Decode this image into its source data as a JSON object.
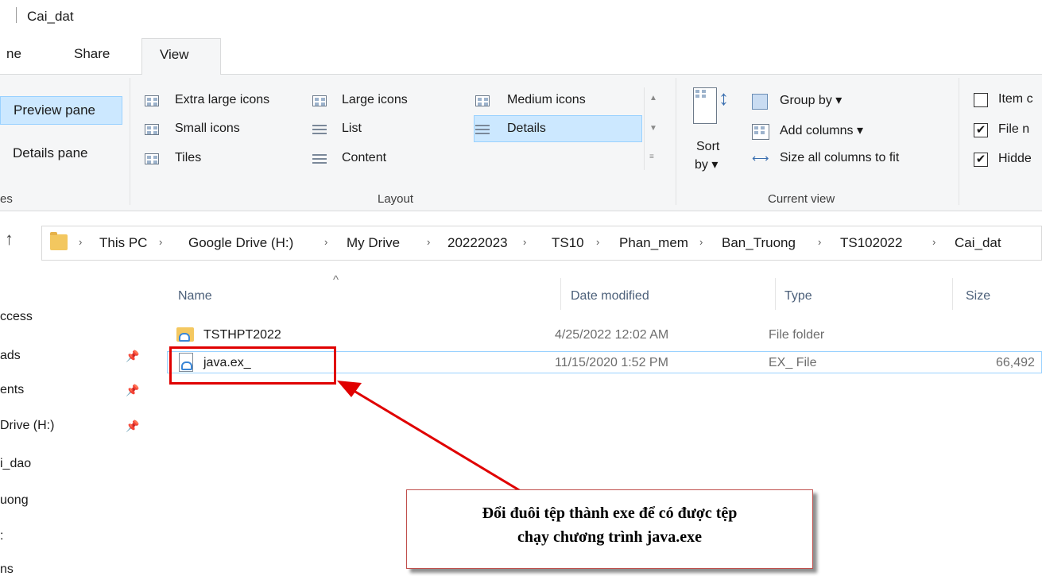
{
  "window": {
    "title": "Cai_dat"
  },
  "tabs": {
    "home": "ne",
    "share": "Share",
    "view": "View"
  },
  "ribbon": {
    "panes": {
      "preview": "Preview pane",
      "details": "Details pane",
      "group_label": "es"
    },
    "layout": {
      "extra_large": "Extra large icons",
      "large": "Large icons",
      "medium": "Medium icons",
      "small": "Small icons",
      "list": "List",
      "details": "Details",
      "tiles": "Tiles",
      "content": "Content",
      "group_label": "Layout"
    },
    "current_view": {
      "sort_by": "Sort",
      "sort_by2": "by ▾",
      "group_by": "Group by ▾",
      "add_columns": "Add columns ▾",
      "size_all": "Size all columns to fit",
      "group_label": "Current view"
    },
    "show_hide": {
      "item_check": "Item c",
      "file_ext": "File n",
      "hidden": "Hidde",
      "item_checked": false,
      "file_ext_checked": true,
      "hidden_checked": true
    }
  },
  "address": {
    "crumbs": [
      "This PC",
      "Google Drive (H:)",
      "My Drive",
      "20222023",
      "TS10",
      "Phan_mem",
      "Ban_Truong",
      "TS102022",
      "Cai_dat"
    ]
  },
  "nav": {
    "items": [
      {
        "label": "ccess",
        "pinned": false
      },
      {
        "label": "ads",
        "pinned": true
      },
      {
        "label": "ents",
        "pinned": true
      },
      {
        "label": "Drive (H:)",
        "pinned": true
      },
      {
        "label": "i_dao",
        "pinned": false
      },
      {
        "label": "uong",
        "pinned": false
      },
      {
        "label": ":",
        "pinned": false
      },
      {
        "label": "ns",
        "pinned": false
      }
    ]
  },
  "files": {
    "columns": {
      "name": "Name",
      "date": "Date modified",
      "type": "Type",
      "size": "Size"
    },
    "rows": [
      {
        "name": "TSTHPT2022",
        "date": "4/25/2022 12:02 AM",
        "type": "File folder",
        "size": "",
        "icon": "cloud-folder-icon"
      },
      {
        "name": "java.ex_",
        "date": "11/15/2020 1:52 PM",
        "type": "EX_ File",
        "size": "66,492",
        "icon": "cloud-file-icon"
      }
    ]
  },
  "annotation": {
    "line1": "Đổi đuôi tệp thành exe để có được tệp",
    "line2": "chạy chương trình java.exe",
    "color": "#e00000"
  }
}
